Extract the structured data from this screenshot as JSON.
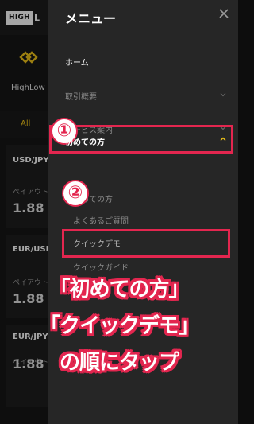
{
  "app": {
    "logo_high": "HIGH",
    "logo_low": "L",
    "brand_name": "HighLow",
    "tab_all": "All",
    "cards": [
      {
        "symbol": "USD/JPY",
        "sub": "ペイアウト",
        "price": "1.88"
      },
      {
        "symbol": "EUR/USD",
        "sub": "ペイアウト",
        "price": "1.88"
      },
      {
        "symbol": "EUR/JPY",
        "sub": "ペイアウト",
        "price": "1.88"
      }
    ]
  },
  "menu": {
    "title": "メニュー",
    "items": [
      {
        "label": "ホーム"
      },
      {
        "label": "取引概要"
      },
      {
        "label": "サービス案内"
      },
      {
        "label": "初めての方"
      }
    ],
    "sub_items": [
      {
        "label": "初めての方"
      },
      {
        "label": "よくあるご質問"
      },
      {
        "label": "クイックデモ"
      },
      {
        "label": "クイックガイド"
      }
    ]
  },
  "annotations": {
    "step1": "①",
    "step2": "②",
    "line1": "「初めての方」",
    "line2": "「クイックデモ」",
    "line3": "の順にタップ"
  },
  "colors": {
    "highlight": "#e3264f",
    "drawer_bg": "#262626",
    "accent_yellow": "#f0c419"
  }
}
